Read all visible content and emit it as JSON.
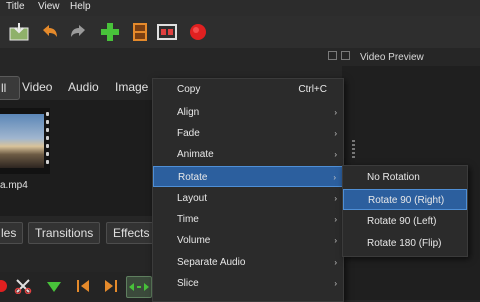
{
  "menubar": {
    "title": "Title",
    "view": "View",
    "help": "Help"
  },
  "toolbar": {
    "icons": [
      "import-files-icon",
      "undo-icon",
      "redo-icon",
      "add-track-icon",
      "export-film-icon",
      "fullscreen-icon",
      "record-icon"
    ]
  },
  "preview": {
    "title": "Video Preview"
  },
  "file_tabs": {
    "all": "ll",
    "video": "Video",
    "audio": "Audio",
    "image": "Image"
  },
  "files": {
    "item_name": "a.mp4"
  },
  "lower_tabs": {
    "files": "les",
    "transitions": "Transitions",
    "effects": "Effects"
  },
  "context_menu": {
    "items": [
      {
        "label": "Copy",
        "shortcut": "Ctrl+C",
        "submenu": false
      },
      {
        "label": "Align",
        "submenu": true
      },
      {
        "label": "Fade",
        "submenu": true
      },
      {
        "label": "Animate",
        "submenu": true
      },
      {
        "label": "Rotate",
        "submenu": true,
        "highlighted": true
      },
      {
        "label": "Layout",
        "submenu": true
      },
      {
        "label": "Time",
        "submenu": true
      },
      {
        "label": "Volume",
        "submenu": true
      },
      {
        "label": "Separate Audio",
        "submenu": true
      },
      {
        "label": "Slice",
        "submenu": true
      }
    ],
    "arrow": "›"
  },
  "rotate_submenu": {
    "items": [
      {
        "label": "No Rotation"
      },
      {
        "label": "Rotate 90 (Right)",
        "highlighted": true
      },
      {
        "label": "Rotate 90 (Left)"
      },
      {
        "label": "Rotate 180 (Flip)"
      }
    ]
  },
  "colors": {
    "highlight": "#2c5f9e",
    "highlight_border": "#4f8fd6",
    "record": "#e02020",
    "add": "#48c23a",
    "undo": "#e58a2b"
  }
}
